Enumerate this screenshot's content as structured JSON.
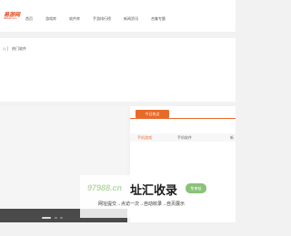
{
  "header": {
    "logo_main": "易游网",
    "logo_sub": "99ddd.com",
    "nav": [
      "首页",
      "游戏库",
      "软件库",
      "手游排行榜",
      "新闻资讯",
      "合集专题"
    ]
  },
  "hot": {
    "icon": "list-icon",
    "title": "热门软件"
  },
  "banner": {
    "dots": 3
  },
  "panel": {
    "tag": "今日热点",
    "tabs": [
      "手机游戏",
      "手机软件",
      "新"
    ]
  },
  "watermark": {
    "domain": "97988.cn",
    "title": "址汇收录",
    "badge": "免审核",
    "subtitle": "网址提交→点访一次→自动收录→自页展示"
  },
  "colors": {
    "accent": "#e86a2a",
    "watermark_green": "#8ac27a"
  }
}
